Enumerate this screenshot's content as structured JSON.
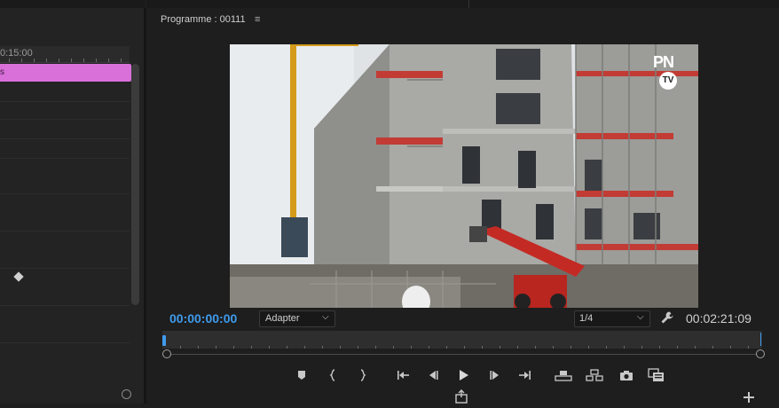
{
  "timeline": {
    "ruler_label": "0:15:00",
    "clip_label": "s"
  },
  "program_monitor": {
    "title": "Programme : 00111",
    "menu_icon": "hamburger-icon",
    "watermark": {
      "top": "PN",
      "bottom": "TV"
    },
    "timecode_current": "00:00:00:00",
    "timecode_duration": "00:02:21:09",
    "fit_select": {
      "selected": "Adapter"
    },
    "resolution_select": {
      "selected": "1/4"
    },
    "accent_color": "#3f9bec",
    "clip_color": "#d96fd9",
    "transport": [
      {
        "name": "add-marker-button",
        "icon": "marker-icon"
      },
      {
        "name": "mark-in-button",
        "icon": "mark-in-icon"
      },
      {
        "name": "mark-out-button",
        "icon": "mark-out-icon"
      },
      {
        "name": "go-to-in-button",
        "icon": "go-to-in-icon"
      },
      {
        "name": "step-back-button",
        "icon": "step-back-icon"
      },
      {
        "name": "play-button",
        "icon": "play-icon"
      },
      {
        "name": "step-forward-button",
        "icon": "step-forward-icon"
      },
      {
        "name": "go-to-out-button",
        "icon": "go-to-out-icon"
      },
      {
        "name": "lift-button",
        "icon": "lift-icon"
      },
      {
        "name": "extract-button",
        "icon": "extract-icon"
      },
      {
        "name": "export-frame-button",
        "icon": "camera-icon"
      },
      {
        "name": "compare-view-button",
        "icon": "compare-icon"
      }
    ]
  }
}
